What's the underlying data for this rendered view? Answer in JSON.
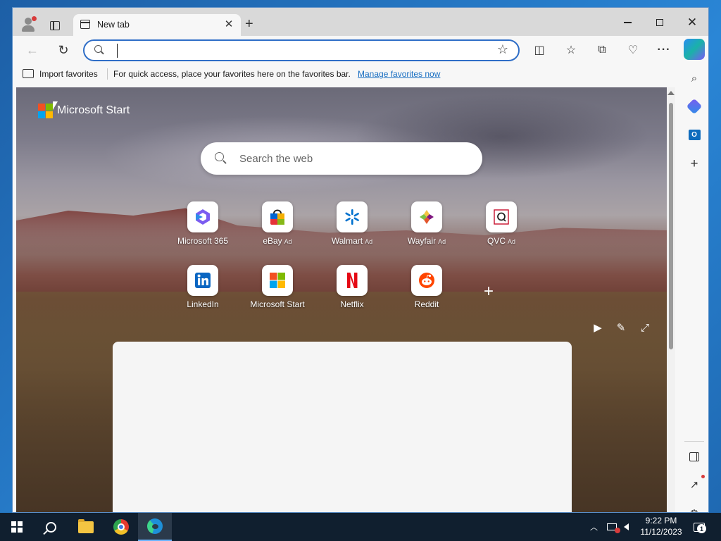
{
  "browser": {
    "tab": {
      "title": "New tab"
    },
    "address_bar": {
      "value": "",
      "placeholder": ""
    },
    "favorites_bar": {
      "import_label": "Import favorites",
      "message": "For quick access, place your favorites here on the favorites bar.",
      "manage_link": "Manage favorites now"
    }
  },
  "new_tab_page": {
    "brand": "Microsoft Start",
    "search": {
      "placeholder": "Search the web"
    },
    "tiles": [
      {
        "label": "Microsoft 365",
        "ad": "",
        "icon": "microsoft-365-icon"
      },
      {
        "label": "eBay",
        "ad": "Ad",
        "icon": "ebay-icon"
      },
      {
        "label": "Walmart",
        "ad": "Ad",
        "icon": "walmart-icon"
      },
      {
        "label": "Wayfair",
        "ad": "Ad",
        "icon": "wayfair-icon"
      },
      {
        "label": "QVC",
        "ad": "Ad",
        "icon": "qvc-icon"
      },
      {
        "label": "LinkedIn",
        "ad": "",
        "icon": "linkedin-icon"
      },
      {
        "label": "Microsoft Start",
        "ad": "",
        "icon": "microsoft-start-icon"
      },
      {
        "label": "Netflix",
        "ad": "",
        "icon": "netflix-icon"
      },
      {
        "label": "Reddit",
        "ad": "",
        "icon": "reddit-icon"
      }
    ]
  },
  "taskbar": {
    "apps": [
      "start-icon",
      "search-icon",
      "file-explorer-icon",
      "chrome-icon",
      "edge-icon"
    ],
    "clock": {
      "time": "9:22 PM",
      "date": "11/12/2023"
    },
    "notification_count": "1"
  },
  "colors": {
    "accent": "#2f6ec7",
    "link": "#1a6fc2",
    "taskbar": "#101f2f",
    "ms_red": "#f25022",
    "ms_green": "#7fba00",
    "ms_blue": "#00a4ef",
    "ms_yellow": "#ffb900"
  }
}
